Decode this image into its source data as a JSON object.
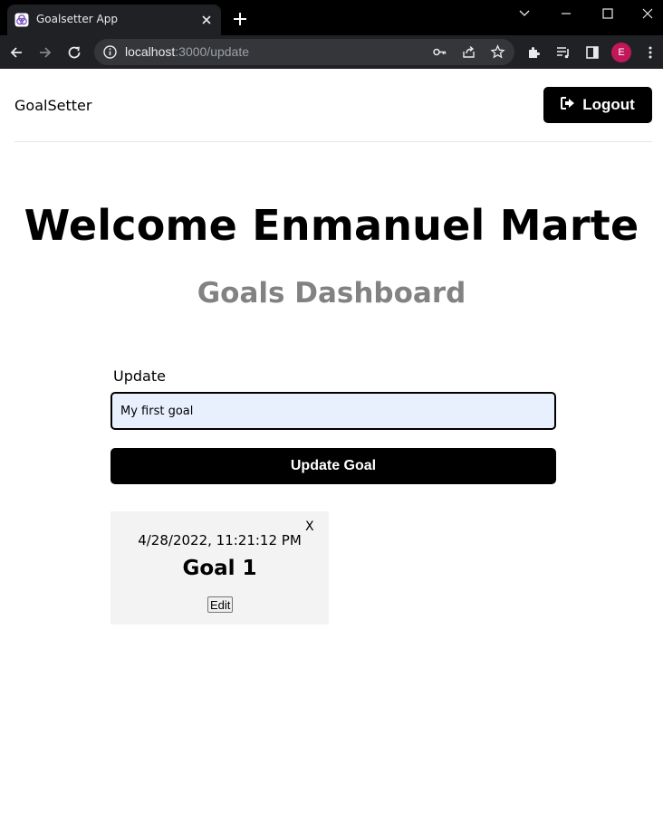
{
  "browser": {
    "tab_title": "Goalsetter App",
    "url_host": "localhost",
    "url_path": ":3000/update",
    "profile_initial": "E",
    "colors": {
      "frame": "#000000",
      "toolbar": "#202124",
      "omnibox": "#35363a",
      "avatar": "#c2185b"
    }
  },
  "header": {
    "brand": "GoalSetter",
    "logout_label": "Logout"
  },
  "main": {
    "welcome": "Welcome Enmanuel Marte",
    "subtitle": "Goals Dashboard",
    "form": {
      "label": "Update",
      "input_value": "My first goal",
      "submit_label": "Update Goal"
    },
    "goals": [
      {
        "date": "4/28/2022, 11:21:12 PM",
        "title": "Goal 1",
        "close_label": "X",
        "edit_label": "Edit"
      }
    ]
  },
  "colors": {
    "accent": "#000000",
    "subtitle": "#828282",
    "input_bg": "#e8f0fe",
    "card_bg": "#f3f3f3"
  }
}
